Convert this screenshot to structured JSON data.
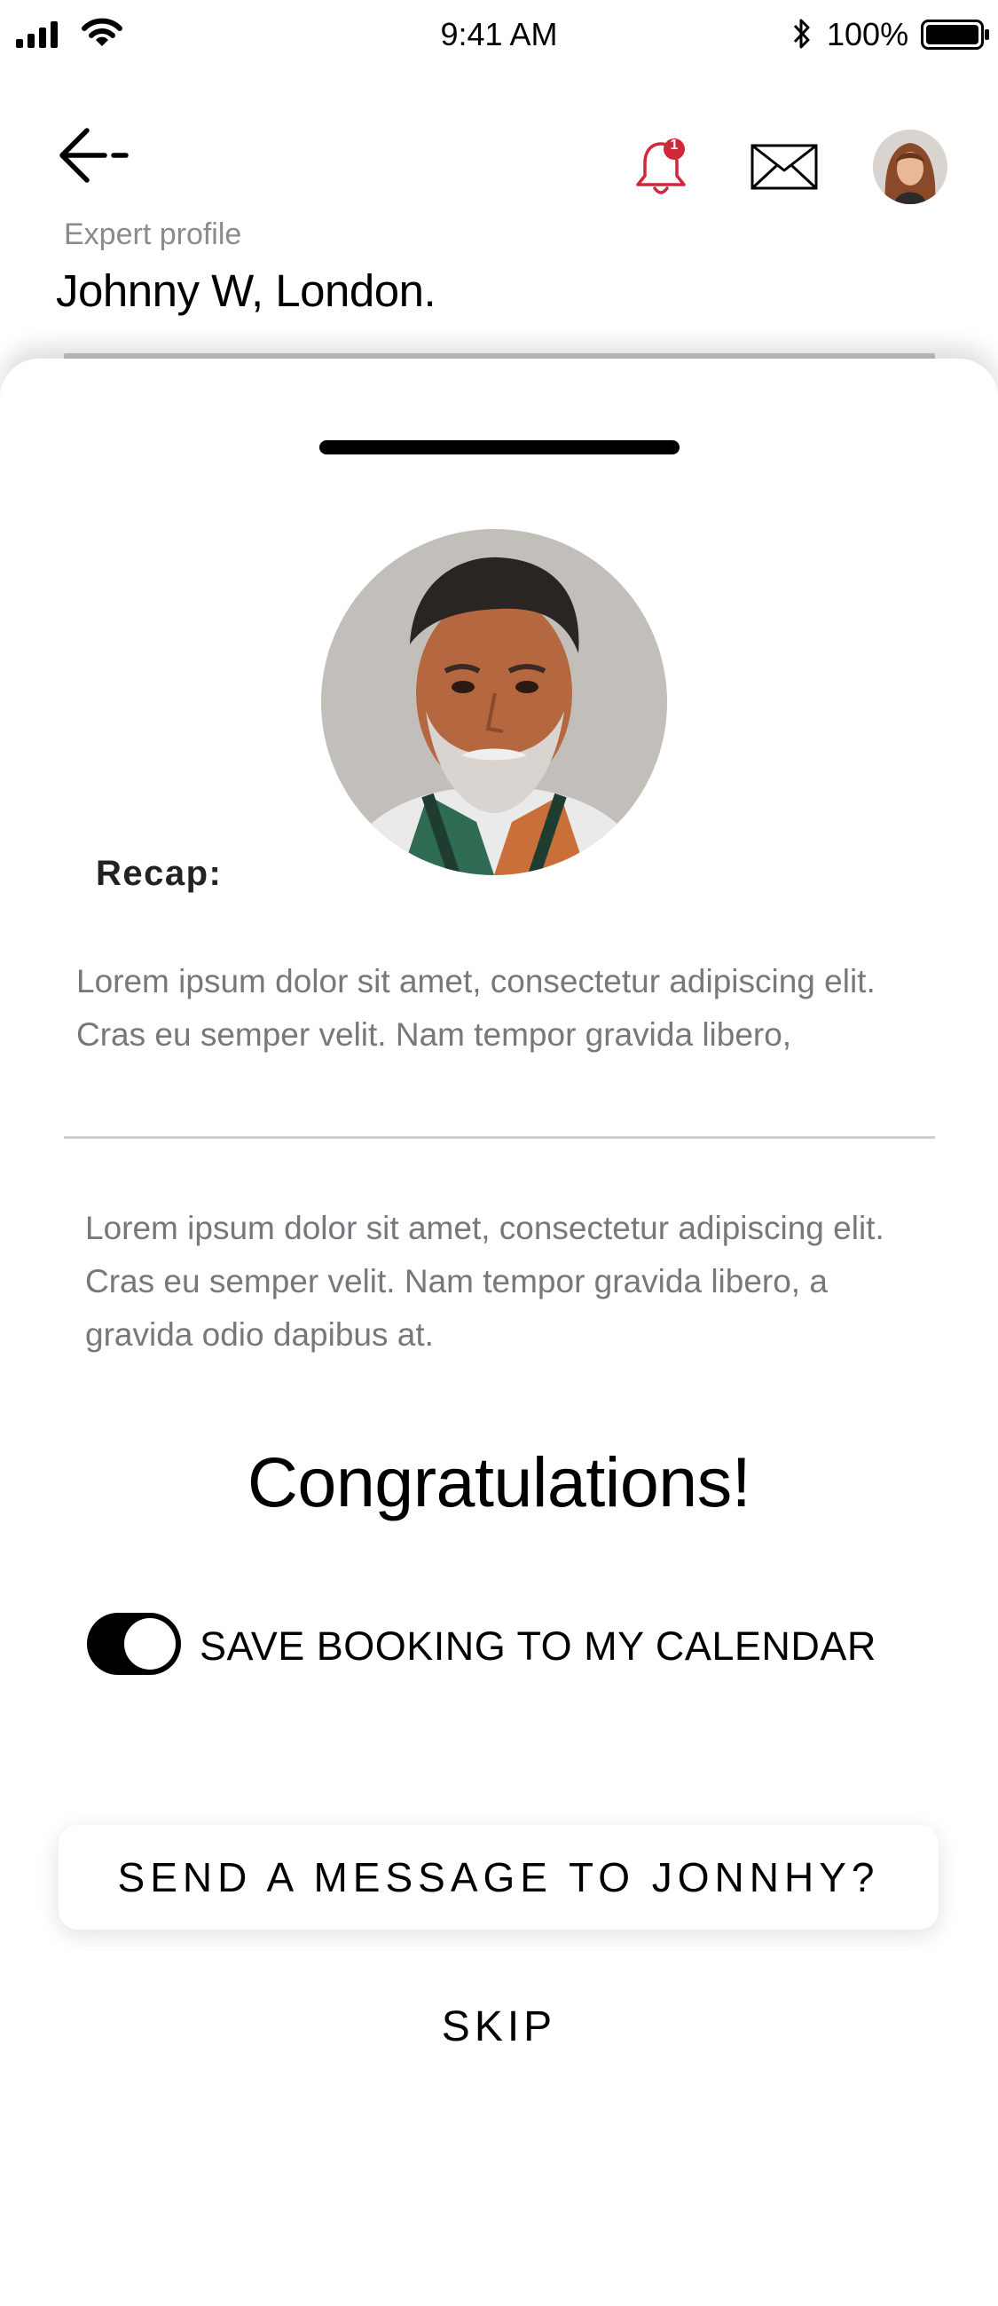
{
  "status_bar": {
    "time": "9:41 AM",
    "battery": "100%"
  },
  "header": {
    "kicker": "Expert profile",
    "title": "Johnny W, London.",
    "notification_count": "1",
    "icons": [
      "back-arrow-icon",
      "bell-icon",
      "mail-icon",
      "avatar"
    ]
  },
  "recap": {
    "label": "Recap:",
    "text": "Lorem ipsum dolor sit amet, consectetur adipiscing elit. Cras eu semper velit. Nam tempor gravida libero,"
  },
  "body": {
    "text": "Lorem ipsum dolor sit amet, consectetur adipiscing elit. Cras eu semper velit. Nam tempor gravida libero, a gravida odio dapibus at."
  },
  "congrats": "Congratulations!",
  "calendar_toggle": {
    "label": "SAVE BOOKING TO MY CALENDAR",
    "on": true
  },
  "actions": {
    "send_message": "SEND A MESSAGE TO JONNHY?",
    "skip": "SKIP"
  },
  "colors": {
    "text_primary": "#000000",
    "text_secondary": "#77777c",
    "badge": "#d0283a",
    "toggle_on": "#000000"
  }
}
